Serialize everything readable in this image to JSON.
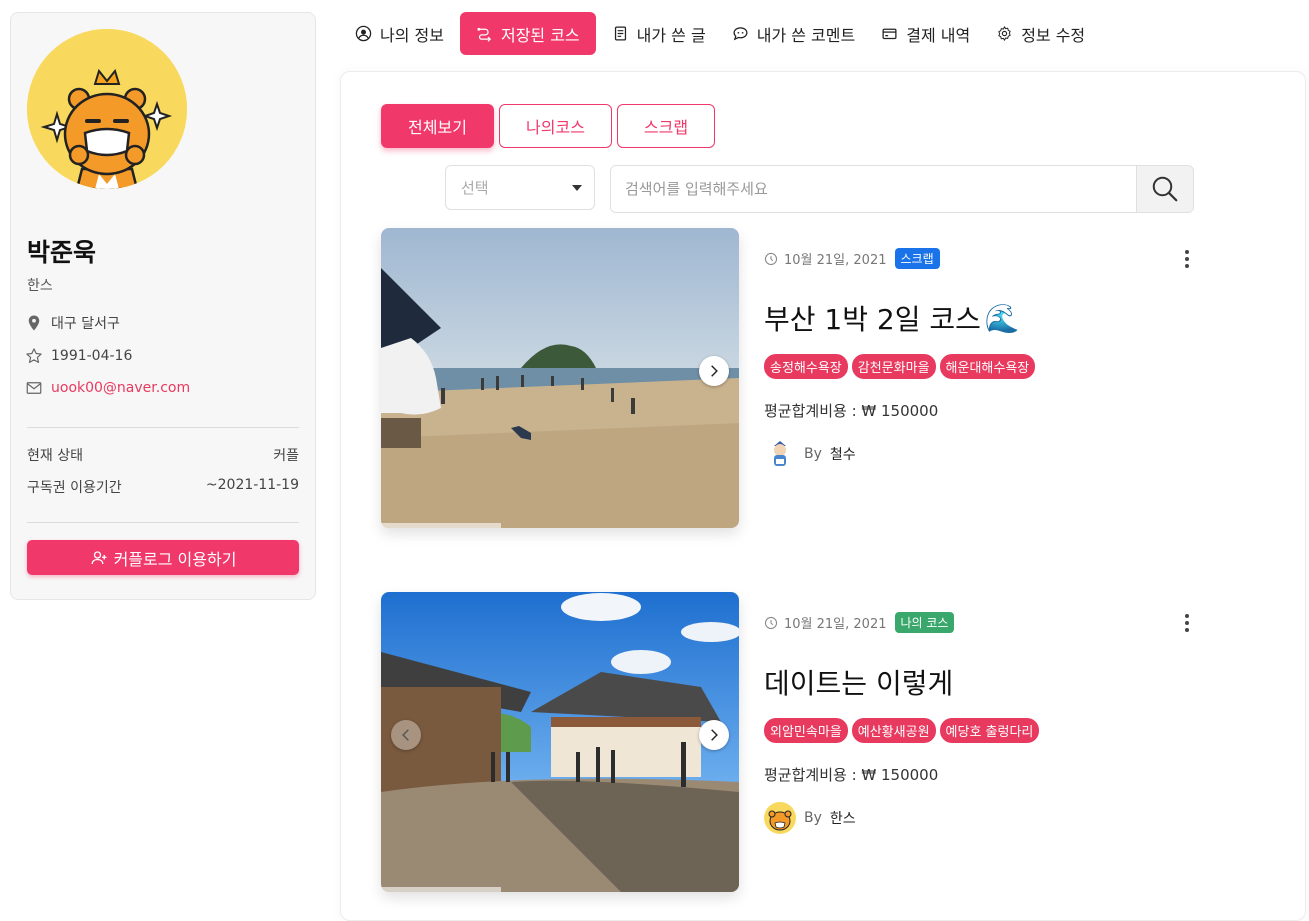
{
  "nav": {
    "items": [
      {
        "label": "나의 정보",
        "icon": "user-circle-icon"
      },
      {
        "label": "저장된 코스",
        "icon": "route-icon",
        "active": true
      },
      {
        "label": "내가 쓴 글",
        "icon": "document-icon"
      },
      {
        "label": "내가 쓴 코멘트",
        "icon": "comment-icon"
      },
      {
        "label": "결제 내역",
        "icon": "credit-card-icon"
      },
      {
        "label": "정보 수정",
        "icon": "gear-icon"
      }
    ]
  },
  "profile": {
    "name": "박준욱",
    "nickname": "한스",
    "location": "대구 달서구",
    "birthday": "1991-04-16",
    "email": "uook00@naver.com",
    "status_label": "현재 상태",
    "status_value": "커플",
    "subscription_label": "구독권 이용기간",
    "subscription_value": "~2021-11-19",
    "couple_button": "커플로그 이용하기"
  },
  "filters": {
    "tabs": [
      "전체보기",
      "나의코스",
      "스크랩"
    ],
    "active_tab": "전체보기",
    "select_placeholder": "선택",
    "search_placeholder": "검색어를 입력해주세요"
  },
  "courses": [
    {
      "date": "10월 21일, 2021",
      "badge": "스크랩",
      "badge_color": "#1a73e8",
      "title": "부산 1박 2일 코스",
      "title_emoji": "🌊",
      "tags": [
        "송정해수욕장",
        "감천문화마을",
        "해운대해수욕장"
      ],
      "cost": "평균합계비용 : ₩ 150000",
      "by": "By",
      "author": "철수"
    },
    {
      "date": "10월 21일, 2021",
      "badge": "나의 코스",
      "badge_color": "#3aa76d",
      "title": "데이트는 이렇게",
      "tags": [
        "외암민속마을",
        "예산황새공원",
        "예당호 출렁다리"
      ],
      "cost": "평균합계비용 : ₩ 150000",
      "by": "By",
      "author": "한스"
    }
  ],
  "colors": {
    "accent": "#f0386b",
    "scrap_badge": "#1a73e8",
    "mycourse_badge": "#3aa76d"
  }
}
